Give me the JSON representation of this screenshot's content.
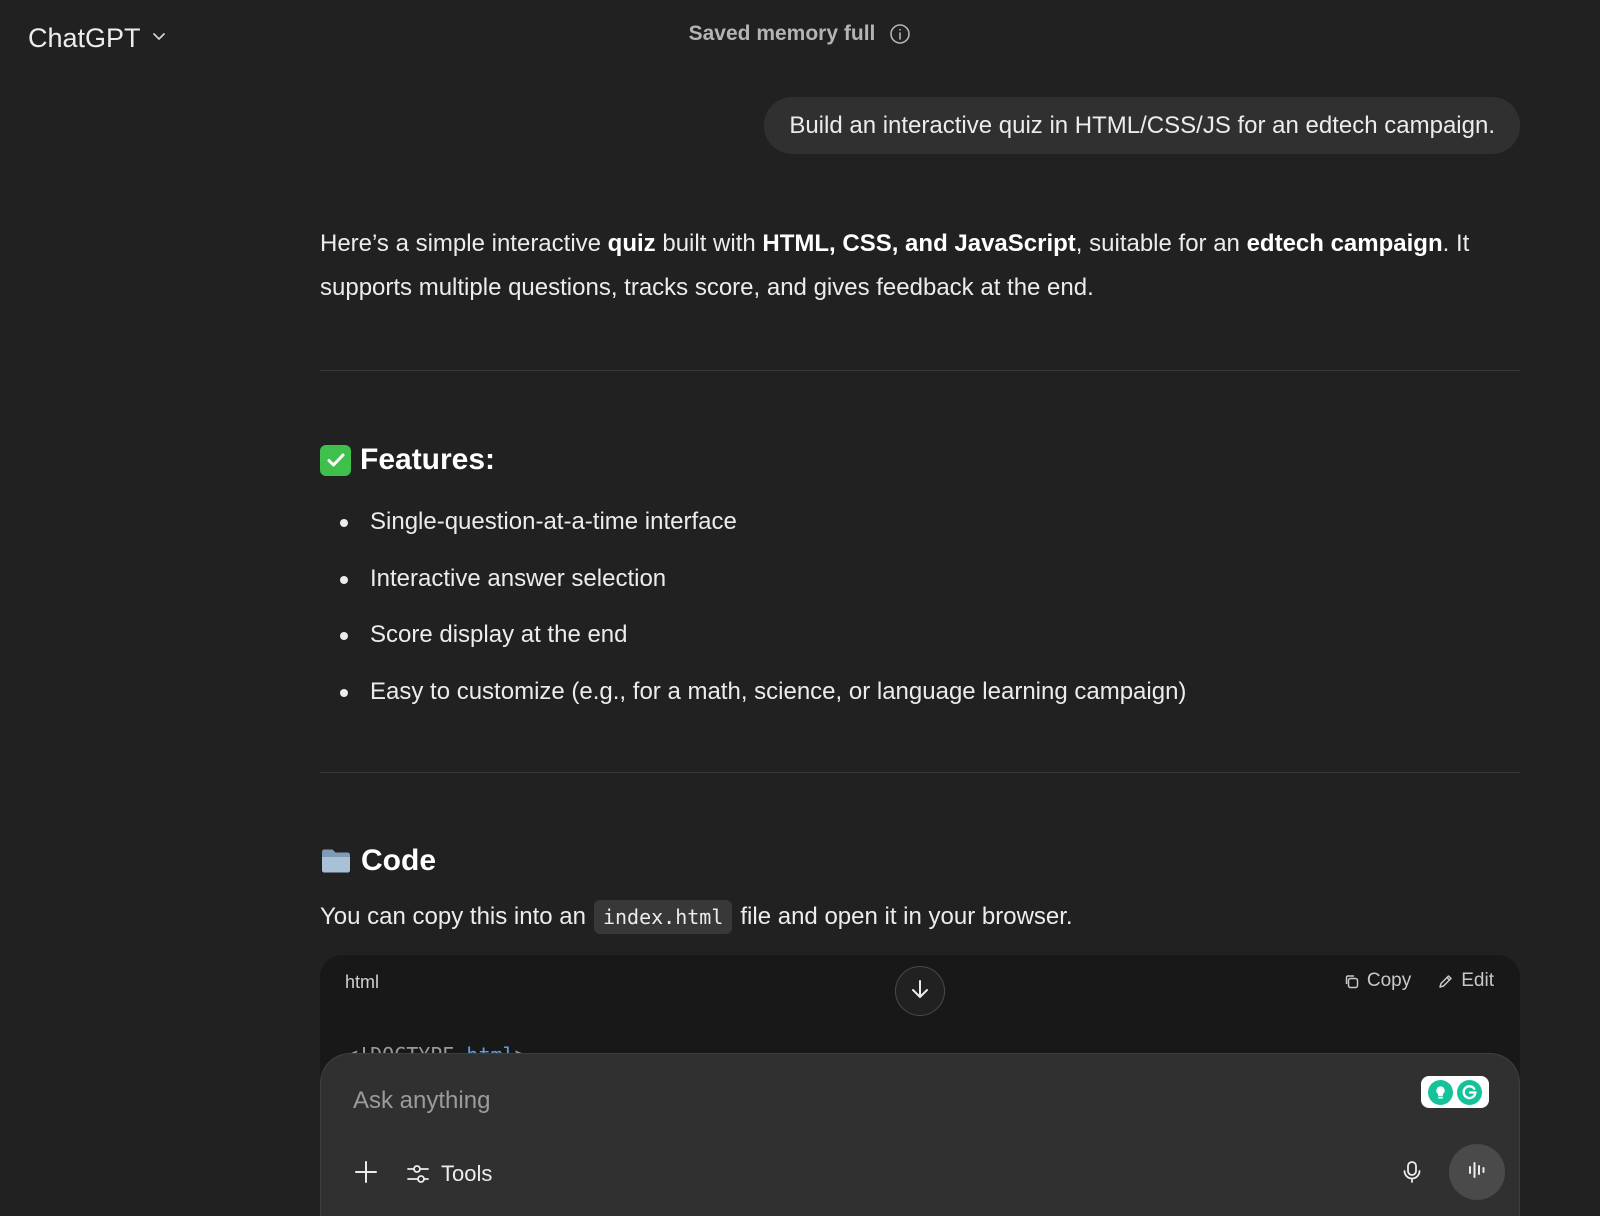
{
  "header": {
    "model_name": "ChatGPT",
    "memory_status": "Saved memory full"
  },
  "user_message": "Build an interactive quiz in HTML/CSS/JS for an edtech campaign.",
  "assistant": {
    "intro": [
      {
        "text": "Here’s a simple interactive ",
        "bold": false
      },
      {
        "text": "quiz",
        "bold": true
      },
      {
        "text": " built with ",
        "bold": false
      },
      {
        "text": "HTML, CSS, and JavaScript",
        "bold": true
      },
      {
        "text": ", suitable for an ",
        "bold": false
      },
      {
        "text": "edtech campaign",
        "bold": true
      },
      {
        "text": ". It supports multiple questions, tracks score, and gives feedback at the end.",
        "bold": false
      }
    ],
    "features_heading": "Features:",
    "features": [
      "Single-question-at-a-time interface",
      "Interactive answer selection",
      "Score display at the end",
      "Easy to customize (e.g., for a math, science, or language learning campaign)"
    ],
    "code_heading": "Code",
    "code_intro_before": "You can copy this into an",
    "code_intro_inline": "index.html",
    "code_intro_after": "file and open it in your browser.",
    "code_block": {
      "language": "html",
      "copy_label": "Copy",
      "edit_label": "Edit",
      "first_line_punct_open": "<!DOCTYPE ",
      "first_line_tag": "html",
      "first_line_punct_close": ">"
    }
  },
  "composer": {
    "placeholder": "Ask anything",
    "tools_label": "Tools"
  },
  "colors": {
    "background": "#212121",
    "surface": "#303030",
    "code_background": "#181818",
    "grammarly_green": "#15c39a",
    "check_green": "#3fbf4c"
  },
  "icons": [
    "chevron-down-icon",
    "info-icon",
    "check-mark-emoji",
    "folder-emoji",
    "arrow-down-icon",
    "copy-icon",
    "edit-icon",
    "plus-icon",
    "sliders-icon",
    "microphone-icon",
    "voice-waveform-icon",
    "grammarly-icon"
  ]
}
